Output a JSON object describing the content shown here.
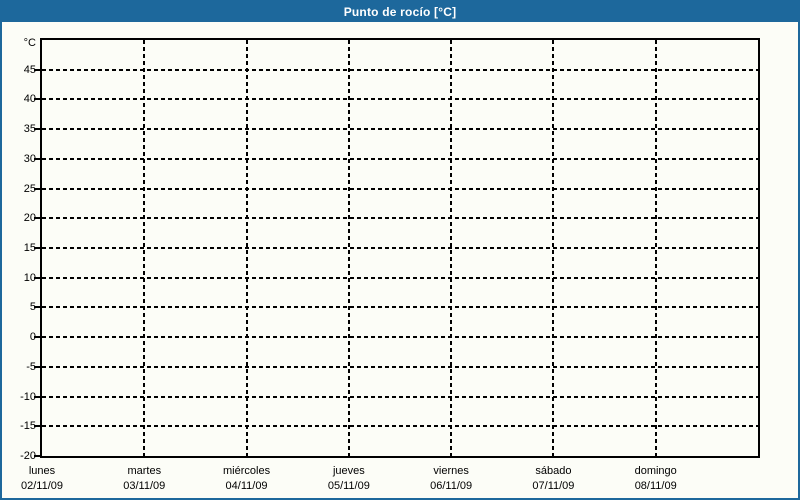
{
  "title": "Punto de rocío [°C]",
  "colors": {
    "titlebar_bg": "#1d689c",
    "window_border": "#1d689c",
    "title_text": "#ffffff",
    "background": "#fcfdf7",
    "axis": "#000000",
    "grid": "#000000",
    "label_text": "#000000"
  },
  "chart_data": {
    "type": "line",
    "title": "Punto de rocío [°C]",
    "xlabel": "",
    "ylabel": "°C",
    "ylim": [
      -20,
      50
    ],
    "ytick_step": 5,
    "yticks": [
      45,
      40,
      35,
      30,
      25,
      20,
      15,
      10,
      5,
      0,
      -5,
      -10,
      -15,
      -20
    ],
    "categories": [
      {
        "day": "lunes",
        "date": "02/11/09"
      },
      {
        "day": "martes",
        "date": "03/11/09"
      },
      {
        "day": "miércoles",
        "date": "04/11/09"
      },
      {
        "day": "jueves",
        "date": "05/11/09"
      },
      {
        "day": "viernes",
        "date": "06/11/09"
      },
      {
        "day": "sábado",
        "date": "07/11/09"
      },
      {
        "day": "domingo",
        "date": "08/11/09"
      }
    ],
    "series": [],
    "grid": "dashed",
    "legend": "none"
  }
}
